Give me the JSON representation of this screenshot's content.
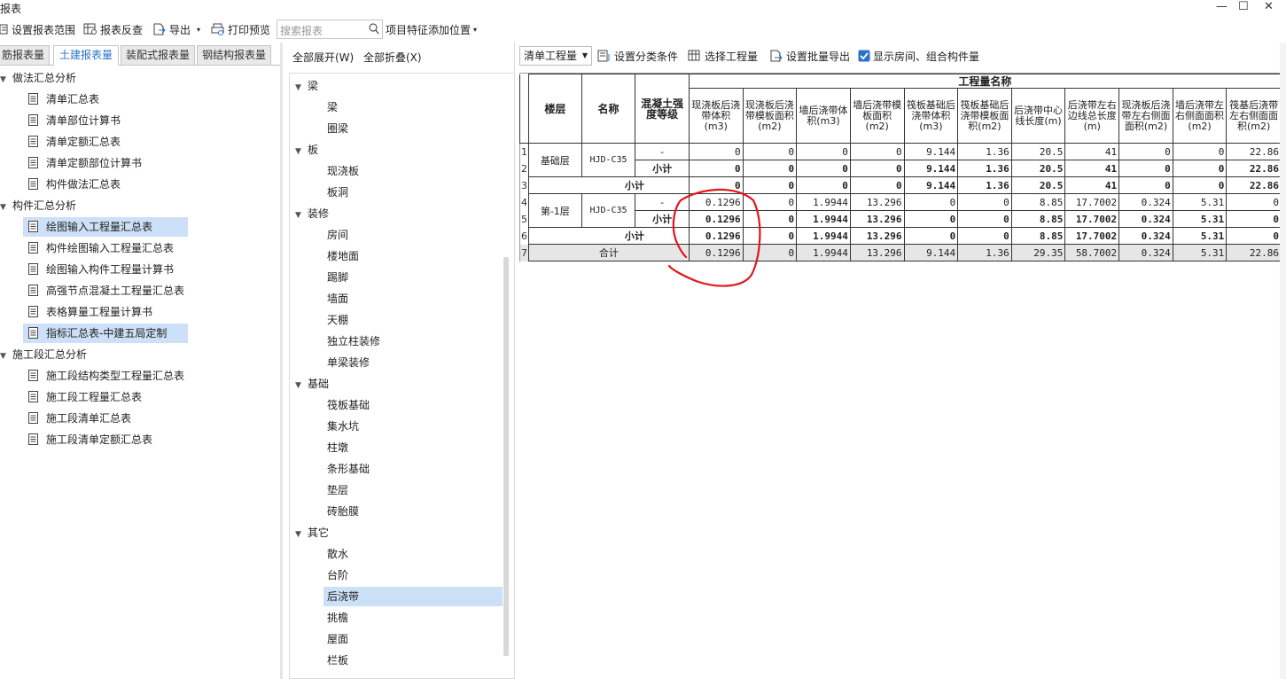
{
  "window": {
    "title": "报表",
    "minimize": "—",
    "maximize": "☐",
    "close": "✕"
  },
  "toolbar": {
    "set_range": "设置报表范围",
    "reverse": "报表反查",
    "export": "导出",
    "print_preview": "打印预览",
    "search_placeholder": "搜索报表",
    "project_feature": "项目特征添加位置"
  },
  "left_tabs": [
    "筋报表量",
    "土建报表量",
    "装配式报表量",
    "钢结构报表量"
  ],
  "left_tree": [
    {
      "label": "做法汇总分析",
      "group": true
    },
    {
      "label": "清单汇总表"
    },
    {
      "label": "清单部位计算书"
    },
    {
      "label": "清单定额汇总表"
    },
    {
      "label": "清单定额部位计算书"
    },
    {
      "label": "构件做法汇总表"
    },
    {
      "label": "构件汇总分析",
      "group": true
    },
    {
      "label": "绘图输入工程量汇总表",
      "selected": true
    },
    {
      "label": "构件绘图输入工程量汇总表"
    },
    {
      "label": "绘图输入构件工程量计算书"
    },
    {
      "label": "高强节点混凝土工程量汇总表"
    },
    {
      "label": "表格算量工程量计算书"
    },
    {
      "label": "指标汇总表-中建五局定制",
      "selected": true
    },
    {
      "label": "施工段汇总分析",
      "group": true
    },
    {
      "label": "施工段结构类型工程量汇总表"
    },
    {
      "label": "施工段工程量汇总表"
    },
    {
      "label": "施工段清单汇总表"
    },
    {
      "label": "施工段清单定额汇总表"
    }
  ],
  "mid_bar": {
    "expand_all": "全部展开(W)",
    "collapse_all": "全部折叠(X)"
  },
  "mid_tree": [
    {
      "label": "梁",
      "group": true
    },
    {
      "label": "梁"
    },
    {
      "label": "圈梁"
    },
    {
      "label": "板",
      "group": true
    },
    {
      "label": "现浇板"
    },
    {
      "label": "板洞"
    },
    {
      "label": "装修",
      "group": true
    },
    {
      "label": "房间"
    },
    {
      "label": "楼地面"
    },
    {
      "label": "踢脚"
    },
    {
      "label": "墙面"
    },
    {
      "label": "天棚"
    },
    {
      "label": "独立柱装修"
    },
    {
      "label": "单梁装修"
    },
    {
      "label": "基础",
      "group": true
    },
    {
      "label": "筏板基础"
    },
    {
      "label": "集水坑"
    },
    {
      "label": "柱墩"
    },
    {
      "label": "条形基础"
    },
    {
      "label": "垫层"
    },
    {
      "label": "砖胎膜"
    },
    {
      "label": "其它",
      "group": true
    },
    {
      "label": "散水"
    },
    {
      "label": "台阶"
    },
    {
      "label": "后浇带",
      "selected": true
    },
    {
      "label": "挑檐"
    },
    {
      "label": "屋面"
    },
    {
      "label": "栏板"
    }
  ],
  "right_bar": {
    "mode": "清单工程量",
    "set_condition": "设置分类条件",
    "select_qty": "选择工程量",
    "batch_export": "设置批量导出",
    "show_rooms": "显示房间、组合构件量",
    "show_rooms_checked": true
  },
  "table": {
    "group_header": "工程量名称",
    "headers": [
      "楼层",
      "名称",
      "混凝土强度等级",
      "现浇板后浇带体积(m3)",
      "现浇板后浇带模板面积(m2)",
      "墙后浇带体积(m3)",
      "墙后浇带模板面积(m2)",
      "筏板基础后浇带体积(m3)",
      "筏板基础后浇带模板面积(m2)",
      "后浇带中心线长度(m)",
      "后浇带左右边线总长度(m)",
      "现浇板后浇带左右侧面面积(m2)",
      "墙后浇带左右侧面面积(m2)",
      "筏基后浇带左右侧面面积(m2)"
    ],
    "rows": [
      {
        "no": "1",
        "floor": "基础层",
        "name": "HJD-C35",
        "grade": "-",
        "vals": [
          "0",
          "0",
          "0",
          "0",
          "9.144",
          "1.36",
          "20.5",
          "41",
          "0",
          "0",
          "22.86"
        ]
      },
      {
        "no": "2",
        "grade": "小计",
        "vals": [
          "0",
          "0",
          "0",
          "0",
          "9.144",
          "1.36",
          "20.5",
          "41",
          "0",
          "0",
          "22.86"
        ]
      },
      {
        "no": "3",
        "label": "小计",
        "vals": [
          "0",
          "0",
          "0",
          "0",
          "9.144",
          "1.36",
          "20.5",
          "41",
          "0",
          "0",
          "22.86"
        ]
      },
      {
        "no": "4",
        "floor": "第-1层",
        "name": "HJD-C35",
        "grade": "-",
        "vals": [
          "0.1296",
          "0",
          "1.9944",
          "13.296",
          "0",
          "0",
          "8.85",
          "17.7002",
          "0.324",
          "5.31",
          "0"
        ]
      },
      {
        "no": "5",
        "grade": "小计",
        "vals": [
          "0.1296",
          "0",
          "1.9944",
          "13.296",
          "0",
          "0",
          "8.85",
          "17.7002",
          "0.324",
          "5.31",
          "0"
        ]
      },
      {
        "no": "6",
        "label": "小计",
        "vals": [
          "0.1296",
          "0",
          "1.9944",
          "13.296",
          "0",
          "0",
          "8.85",
          "17.7002",
          "0.324",
          "5.31",
          "0"
        ]
      },
      {
        "no": "7",
        "label": "合计",
        "vals": [
          "0.1296",
          "0",
          "1.9944",
          "13.296",
          "9.144",
          "1.36",
          "29.35",
          "58.7002",
          "0.324",
          "5.31",
          "22.86"
        ]
      }
    ]
  },
  "annotation_color": "#e0161b"
}
